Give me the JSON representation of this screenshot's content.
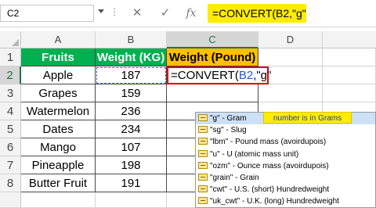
{
  "formula_bar": {
    "name_box": "C2",
    "dots": "⋮",
    "cancel_icon": "✕",
    "enter_icon": "✓",
    "fx_label": "fx",
    "formula_text": "=CONVERT(B2,\"g\""
  },
  "columns": [
    "A",
    "B",
    "C",
    "D"
  ],
  "rows": [
    "1",
    "2",
    "3",
    "4",
    "5",
    "6",
    "7",
    "8"
  ],
  "table": {
    "headers": {
      "fruits": "Fruits",
      "weight_kg": "Weight (KG)",
      "weight_pound": "Weight (Pound)"
    },
    "rows": [
      {
        "fruit": "Apple",
        "kg": "187"
      },
      {
        "fruit": "Grapes",
        "kg": "159"
      },
      {
        "fruit": "Watermelon",
        "kg": "236"
      },
      {
        "fruit": "Dates",
        "kg": "234"
      },
      {
        "fruit": "Mango",
        "kg": "107"
      },
      {
        "fruit": "Pineapple",
        "kg": "198"
      },
      {
        "fruit": "Butter Fruit",
        "kg": "191"
      }
    ]
  },
  "editing_cell": {
    "prefix": "=CONVERT(",
    "ref": "B2",
    "suffix": ",\"g\""
  },
  "autocomplete": {
    "items": [
      "\"g\" - Gram",
      "\"sg\" - Slug",
      "\"lbm\" - Pound mass (avoirdupois)",
      "\"u\" - U (atomic mass unit)",
      "\"ozm\" - Ounce mass (avoirdupois)",
      "\"grain\" - Grain",
      "\"cwt\" - U.S. (short) Hundredweight",
      "\"uk_cwt\" - U.K. (long) Hundredweight"
    ],
    "tooltip": "number is in Grams"
  },
  "colors": {
    "header_green": "#00b050",
    "header_orange": "#ffc000",
    "formula_highlight": "#ffec00",
    "edit_border": "#e00000"
  }
}
